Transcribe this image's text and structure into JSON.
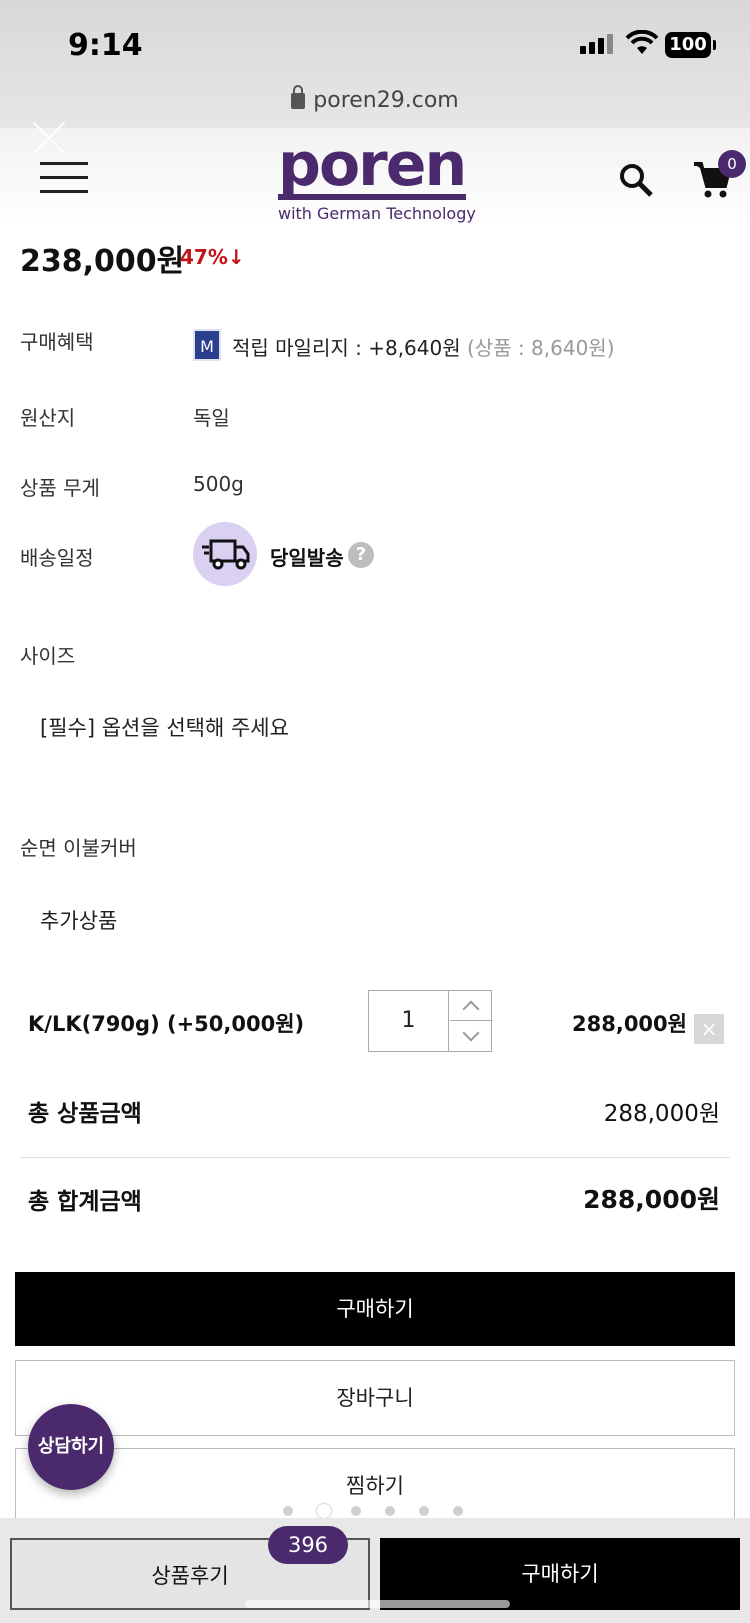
{
  "status_bar": {
    "time": "9:14",
    "battery": "100"
  },
  "browser": {
    "url": "poren29.com"
  },
  "header": {
    "logo_text": "poren",
    "logo_tagline": "with German Technology",
    "cart_count": "0"
  },
  "product": {
    "price": "238,000원",
    "discount": "47%↓",
    "benefit_label": "구매혜택",
    "mileage_icon_letter": "M",
    "mileage_text": "적립 마일리지 : +8,640원",
    "mileage_detail": "(상품 : 8,640원)",
    "origin_label": "원산지",
    "origin_value": "독일",
    "weight_label": "상품 무게",
    "weight_value": "500g",
    "shipping_label": "배송일정",
    "shipping_value": "당일발송",
    "help_icon": "?"
  },
  "options": {
    "size_label": "사이즈",
    "size_placeholder": "[필수] 옵션을 선택해 주세요",
    "cover_label": "순면 이불커버",
    "cover_placeholder": "추가상품"
  },
  "selected_item": {
    "name": "K/LK(790g) (+50,000원)",
    "quantity": "1",
    "price": "288,000원",
    "remove_icon": "×"
  },
  "totals": {
    "product_total_label": "총 상품금액",
    "product_total_value": "288,000원",
    "grand_total_label": "총 합계금액",
    "grand_total_value": "288,000원"
  },
  "actions": {
    "buy": "구매하기",
    "cart": "장바구니",
    "wishlist": "찜하기",
    "consult": "상담하기"
  },
  "bottom_bar": {
    "review_label": "상품후기",
    "review_count": "396",
    "buy_label": "구매하기"
  },
  "colors": {
    "brand": "#4a2a6c",
    "discount": "#c0141a",
    "shipping_circle": "#d9d0f2"
  }
}
